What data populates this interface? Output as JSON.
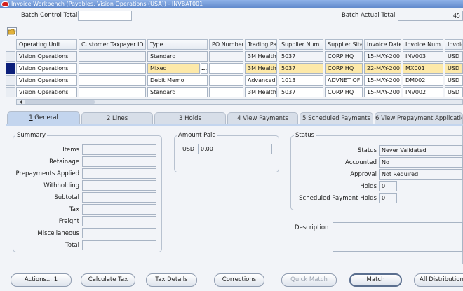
{
  "window": {
    "title": "Invoice Workbench (Payables, Vision Operations (USA)) - INVBAT001"
  },
  "batch": {
    "control_total_label": "Batch Control Total",
    "control_total_value": "",
    "actual_total_label": "Batch Actual Total",
    "actual_total_value": "45"
  },
  "table": {
    "columns": [
      "Operating Unit",
      "Customer Taxpayer ID",
      "Type",
      "PO Number",
      "Trading Pa",
      "Supplier Num",
      "Supplier Site",
      "Invoice Date",
      "Invoice Num",
      "Invoic"
    ],
    "rows": [
      {
        "operating_unit": "Vision Operations",
        "taxpayer": "",
        "type": "Standard",
        "po": "",
        "trading": "3M Health",
        "supplier_num": "5037",
        "site": "CORP HQ",
        "date": "15-MAY-200",
        "num": "INV003",
        "cur": "USD"
      },
      {
        "operating_unit": "Vision Operations",
        "taxpayer": "",
        "type": "Mixed",
        "po": "",
        "trading": "3M Health",
        "supplier_num": "5037",
        "site": "CORP HQ",
        "date": "22-MAY-200",
        "num": "MX001",
        "cur": "USD"
      },
      {
        "operating_unit": "Vision Operations",
        "taxpayer": "",
        "type": "Debit Memo",
        "po": "",
        "trading": "Advanced I",
        "supplier_num": "1013",
        "site": "ADVNET OF",
        "date": "15-MAY-200",
        "num": "DM002",
        "cur": "USD"
      },
      {
        "operating_unit": "Vision Operations",
        "taxpayer": "",
        "type": "Standard",
        "po": "",
        "trading": "3M Health",
        "supplier_num": "5037",
        "site": "CORP HQ",
        "date": "15-MAY-200",
        "num": "INV002",
        "cur": "USD"
      }
    ],
    "lov_glyph": "…"
  },
  "tabs": [
    {
      "num": "1",
      "label": " General"
    },
    {
      "num": "2",
      "label": " Lines"
    },
    {
      "num": "3",
      "label": " Holds"
    },
    {
      "num": "4",
      "label": " View Payments"
    },
    {
      "num": "5",
      "label": " Scheduled Payments"
    },
    {
      "num": "6",
      "label": " View Prepayment Applications"
    }
  ],
  "summary": {
    "title": "Summary",
    "items": [
      "Items",
      "Retainage",
      "Prepayments Applied",
      "Withholding",
      "Subtotal",
      "Tax",
      "Freight",
      "Miscellaneous",
      "Total"
    ]
  },
  "amount_paid": {
    "title": "Amount Paid",
    "currency": "USD",
    "value": "0.00"
  },
  "status": {
    "title": "Status",
    "status_label": "Status",
    "status_value": "Never Validated",
    "accounted_label": "Accounted",
    "accounted_value": "No",
    "approval_label": "Approval",
    "approval_value": "Not Required",
    "holds_label": "Holds",
    "holds_value": "0",
    "sched_holds_label": "Scheduled Payment Holds",
    "sched_holds_value": "0"
  },
  "description": {
    "label": "Description",
    "value": ""
  },
  "buttons": {
    "actions": "Actions... 1",
    "calculate_tax": "Calculate Tax",
    "tax_details": "Tax Details",
    "corrections": "Corrections",
    "quick_match": "Quick Match",
    "match": "Match",
    "all_distributions": "All Distributions"
  },
  "colors": {
    "accent": "#5d86c9",
    "selected_row": "#0b1f7a",
    "highlight": "#fde9a9"
  },
  "icons": {
    "folder": "folder-open-icon",
    "app": "oracle-app-icon",
    "scroll_left": "arrow-left-icon"
  }
}
